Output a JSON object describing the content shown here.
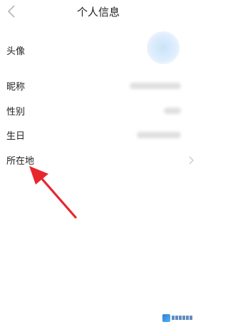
{
  "header": {
    "title": "个人信息",
    "back_icon": "chevron-left-icon"
  },
  "rows": [
    {
      "key": "avatar",
      "label": "头像"
    },
    {
      "key": "nickname",
      "label": "昵称"
    },
    {
      "key": "gender",
      "label": "性别"
    },
    {
      "key": "birthday",
      "label": "生日"
    },
    {
      "key": "location",
      "label": "所在地"
    }
  ],
  "annotation": {
    "type": "arrow",
    "color": "#e8262e",
    "points_to": "所在地"
  },
  "watermark": {
    "logo": "site-logo-icon"
  },
  "colors": {
    "accent": "#e8262e",
    "avatar": "#cfe6fb",
    "watermark": "#3b6fb0"
  }
}
